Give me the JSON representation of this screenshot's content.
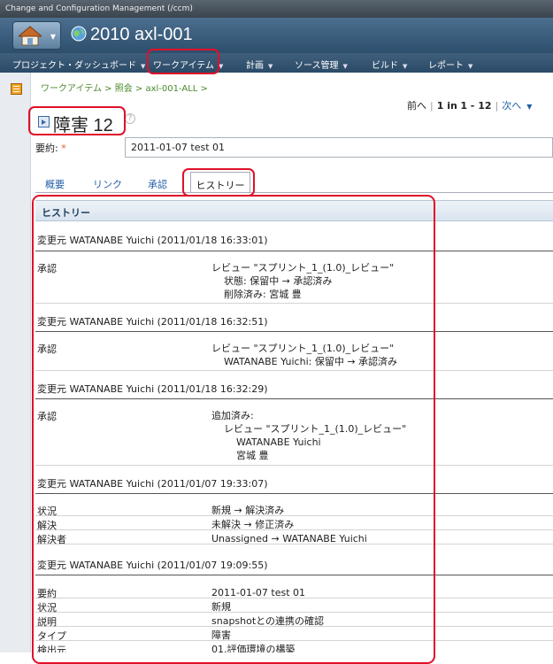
{
  "app": {
    "window_title": "Change and Configuration Management (/ccm)"
  },
  "project": {
    "title": "2010 axl-001",
    "icons": [
      "home-icon",
      "globe-icon"
    ]
  },
  "menu": [
    {
      "label": "プロジェクト・ダッシュボード"
    },
    {
      "label": "ワークアイテム"
    },
    {
      "label": "計画"
    },
    {
      "label": "ソース管理"
    },
    {
      "label": "ビルド"
    },
    {
      "label": "レポート"
    }
  ],
  "breadcrumb": "ワークアイテム > 照会 > axl-001-ALL >",
  "pager": {
    "prev": "前へ",
    "range_prefix": "1 in",
    "range": "1 - 12",
    "next": "次へ"
  },
  "work_item": {
    "title": "障害 12",
    "summary_label": "要約:",
    "required_mark": "*",
    "summary_value": "2011-01-07 test 01"
  },
  "tabs": [
    {
      "label": "概要"
    },
    {
      "label": "リンク"
    },
    {
      "label": "承認"
    },
    {
      "label": "ヒストリー",
      "active": true
    }
  ],
  "history": {
    "heading": "ヒストリー",
    "changes": [
      {
        "by": "変更元 WATANABE Yuichi (2011/01/18 16:33:01)",
        "rows": [
          {
            "field": "承認",
            "lines": [
              "レビュー \"スプリント_1_(1.0)_レビュー\"",
              "    状態: 保留中 → 承認済み",
              "    削除済み: 宮城 豊"
            ]
          }
        ]
      },
      {
        "by": "変更元 WATANABE Yuichi (2011/01/18 16:32:51)",
        "rows": [
          {
            "field": "承認",
            "lines": [
              "レビュー \"スプリント_1_(1.0)_レビュー\"",
              "    WATANABE Yuichi: 保留中 → 承認済み"
            ]
          }
        ]
      },
      {
        "by": "変更元 WATANABE Yuichi (2011/01/18 16:32:29)",
        "rows": [
          {
            "field": "承認",
            "lines": [
              "追加済み:",
              "    レビュー \"スプリント_1_(1.0)_レビュー\"",
              "        WATANABE Yuichi",
              "        宮城 豊"
            ]
          }
        ]
      },
      {
        "by": "変更元 WATANABE Yuichi (2011/01/07 19:33:07)",
        "rows": [
          {
            "field": "状況",
            "lines": [
              "新規 → 解決済み"
            ]
          },
          {
            "field": "解決",
            "lines": [
              "未解決 → 修正済み"
            ]
          },
          {
            "field": "解決者",
            "lines": [
              "Unassigned → WATANABE Yuichi"
            ]
          }
        ]
      },
      {
        "by": "変更元 WATANABE Yuichi (2011/01/07 19:09:55)",
        "rows": [
          {
            "field": "要約",
            "lines": [
              "2011-01-07 test 01"
            ]
          },
          {
            "field": "状況",
            "lines": [
              "新規"
            ]
          },
          {
            "field": "説明",
            "lines": [
              "snapshotとの連携の確認"
            ]
          },
          {
            "field": "タイプ",
            "lines": [
              "障害"
            ]
          },
          {
            "field": "検出元",
            "lines": [
              "01.評価環境の構築"
            ]
          }
        ]
      }
    ]
  },
  "colors": {
    "annotation": "#e0102a",
    "link": "#2360a8",
    "breadcrumb": "#4a8a2a",
    "menubar": "#2b4a67"
  }
}
